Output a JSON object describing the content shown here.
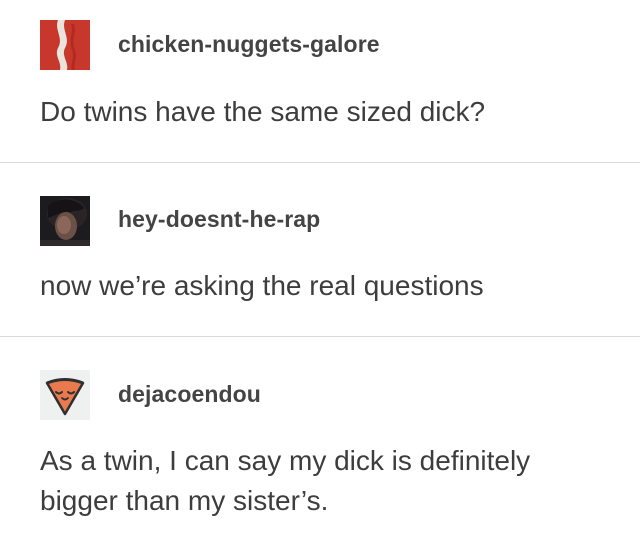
{
  "posts": [
    {
      "username": "chicken-nuggets-galore",
      "avatar_icon": "red-bacon-avatar-icon",
      "text": "Do twins have the same sized dick?"
    },
    {
      "username": "hey-doesnt-he-rap",
      "avatar_icon": "dark-photo-avatar-icon",
      "text": "now we’re asking the real questions"
    },
    {
      "username": "dejacoendou",
      "avatar_icon": "pizza-slice-avatar-icon",
      "text": "As a twin, I can say my dick is definitely bigger than my sister’s."
    }
  ],
  "colors": {
    "divider": "#d9d9d9",
    "username": "#444444",
    "body_text": "#3d3d3d",
    "avatar_red": "#c8372c",
    "pizza_orange": "#e97a4e"
  }
}
